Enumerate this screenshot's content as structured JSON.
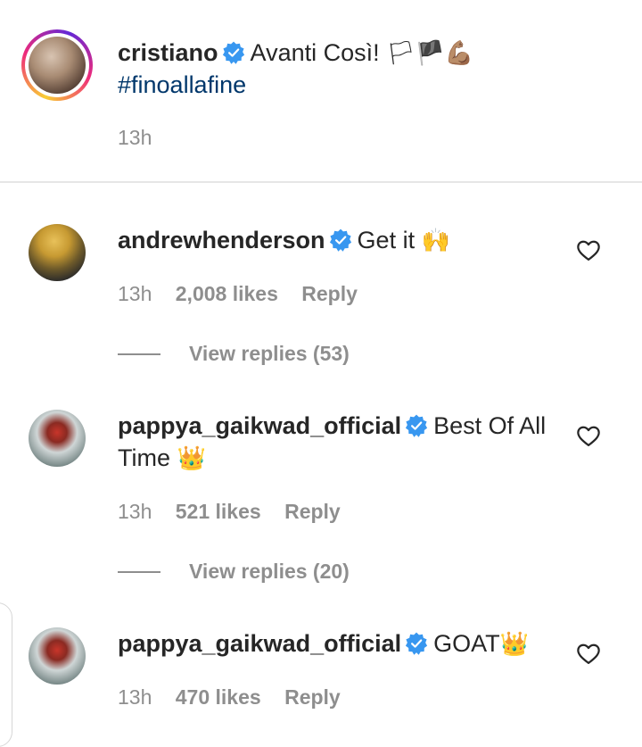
{
  "caption": {
    "username": "cristiano",
    "text": "Avanti Così!",
    "emojis": "🏳🏴💪🏽",
    "hashtag": "#finoallafine",
    "time": "13h"
  },
  "comments": [
    {
      "username": "andrewhenderson",
      "text": "Get it",
      "emoji": "🙌",
      "time": "13h",
      "likes": "2,008 likes",
      "reply_label": "Reply",
      "view_replies": "View replies (53)"
    },
    {
      "username": "pappya_gaikwad_official",
      "text_line1": "Best Of All",
      "text_line2": "Time",
      "emoji": "👑",
      "time": "13h",
      "likes": "521 likes",
      "reply_label": "Reply",
      "view_replies": "View replies (20)"
    },
    {
      "username": "pappya_gaikwad_official",
      "text": "GOAT",
      "emoji": "👑",
      "time": "13h",
      "likes": "470 likes",
      "reply_label": "Reply"
    }
  ],
  "icons": {
    "verified": "verified-badge-icon",
    "like": "heart-outline-icon"
  },
  "colors": {
    "verified_blue": "#3897f0",
    "hashtag": "#00376b",
    "muted": "#8e8e8e",
    "text": "#262626"
  }
}
